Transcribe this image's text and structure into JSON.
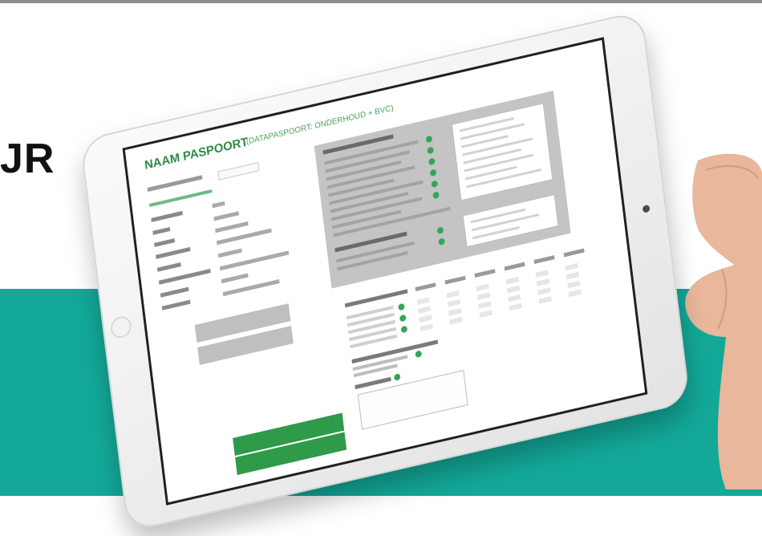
{
  "page": {
    "headline_fragment": "JR"
  },
  "tablet_screen": {
    "title": "NAAM PASPOORT",
    "subtitle": "(DATAPASPOORT: ONDERHOUD + BVC)",
    "fields": [],
    "buttons": {
      "upper_button_1": "",
      "upper_button_2": "",
      "green_button_1": "",
      "green_button_2": ""
    },
    "panel_sections": {
      "a": "",
      "b": "",
      "c": "",
      "d": "",
      "e": ""
    }
  },
  "colors": {
    "teal_band": "#13a898",
    "brand_green": "#2e8b45",
    "top_rule": "#8f8f8f",
    "panel_gray": "#c4c4c4"
  },
  "icons": [
    "camera-icon",
    "home-button-icon",
    "add-circle-icon"
  ]
}
